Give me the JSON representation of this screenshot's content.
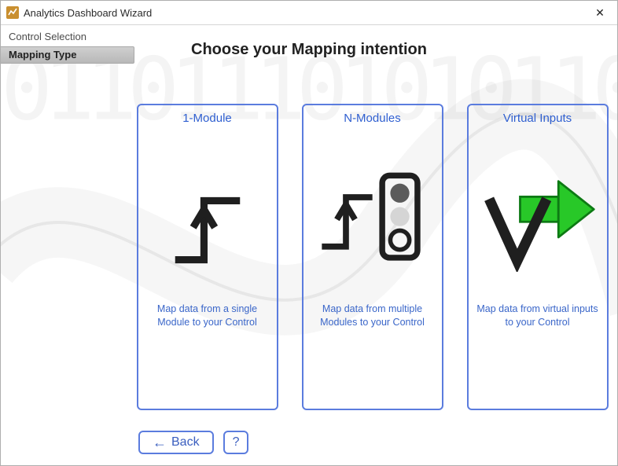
{
  "window": {
    "title": "Analytics Dashboard Wizard"
  },
  "sidebar": {
    "step0": "Control Selection",
    "step1": "Mapping Type"
  },
  "heading": "Choose your Mapping intention",
  "cards": {
    "c0": {
      "title": "1-Module",
      "desc": "Map data from a single Module to your Control"
    },
    "c1": {
      "title": "N-Modules",
      "desc": "Map data from multiple Modules to your Control"
    },
    "c2": {
      "title": "Virtual Inputs",
      "desc": "Map data from virtual inputs to your Control"
    }
  },
  "footer": {
    "back": "Back",
    "help": "?"
  }
}
